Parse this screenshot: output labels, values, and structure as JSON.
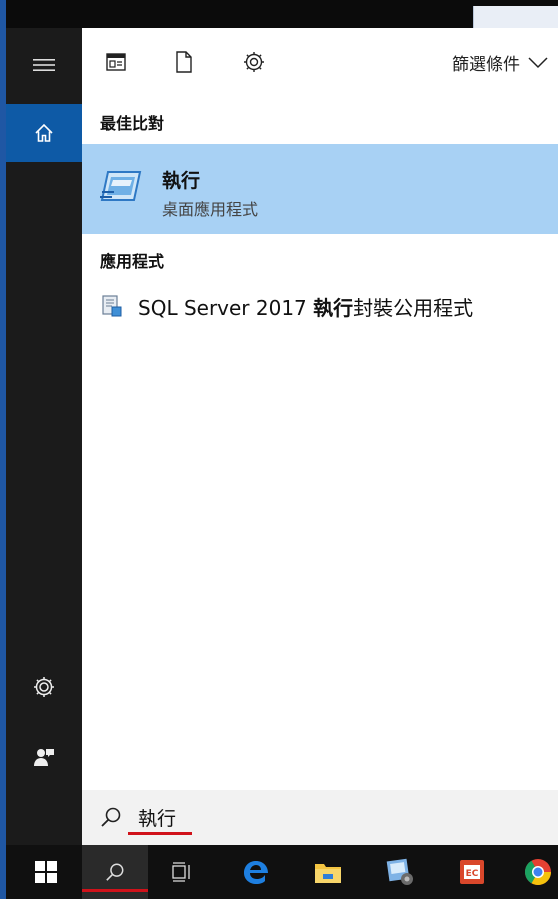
{
  "toolbar": {
    "filter_label": "篩選條件"
  },
  "sections": {
    "best_match_header": "最佳比對",
    "apps_header": "應用程式"
  },
  "best_match": {
    "title": "執行",
    "subtitle": "桌面應用程式"
  },
  "apps": [
    {
      "prefix": "SQL Server 2017 ",
      "bold": "執行",
      "suffix": "封裝公用程式"
    }
  ],
  "search": {
    "value": "執行"
  },
  "colors": {
    "accent": "#0e5aa6",
    "selection": "#a8d1f4",
    "underline": "#d0121a"
  },
  "icons": {
    "rail": [
      "hamburger-icon",
      "home-icon",
      "settings-icon",
      "user-feedback-icon"
    ],
    "toolbar": [
      "app-view-icon",
      "document-icon",
      "settings-icon",
      "chevron-down-icon"
    ],
    "taskbar": [
      "windows-start-icon",
      "search-icon",
      "task-view-icon",
      "edge-icon",
      "file-explorer-icon",
      "app-icon",
      "office-app-icon",
      "chrome-icon"
    ]
  }
}
